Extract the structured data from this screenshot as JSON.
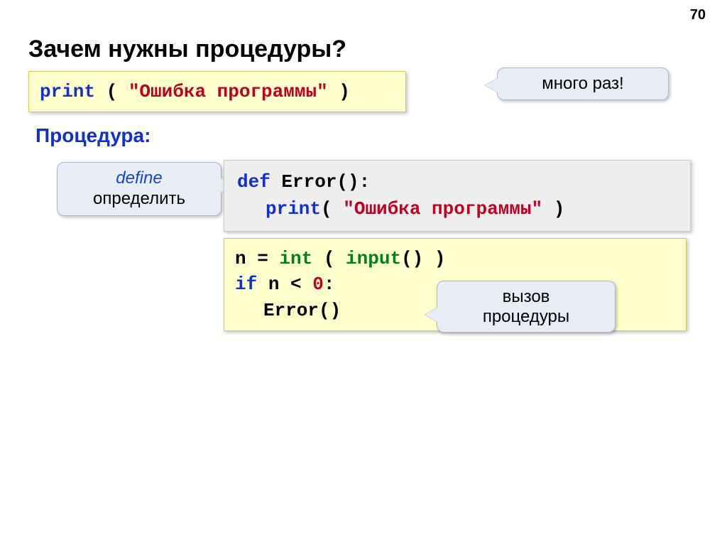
{
  "page_number": "70",
  "title": "Зачем нужны процедуры?",
  "box1": {
    "print": "print",
    "open": " ( ",
    "str": "\"Ошибка программы\"",
    "close": " )"
  },
  "call1": "много раз!",
  "subtitle": "Процедура:",
  "call2": {
    "line1": "define",
    "line2": "определить"
  },
  "box2": {
    "l1a": "def",
    "l1b": " Error():",
    "l2a": "print",
    "l2b": "( ",
    "l2c": "\"Ошибка программы\"",
    "l2d": " )"
  },
  "box3": {
    "l1a": "n = ",
    "l1b": "int",
    "l1c": " ( ",
    "l1d": "input",
    "l1e": "() )",
    "l2a": "if",
    "l2b": " n < ",
    "l2c": "0",
    "l2d": ":",
    "l3": "Error()"
  },
  "call3": {
    "line1": "вызов",
    "line2": "процедуры"
  }
}
